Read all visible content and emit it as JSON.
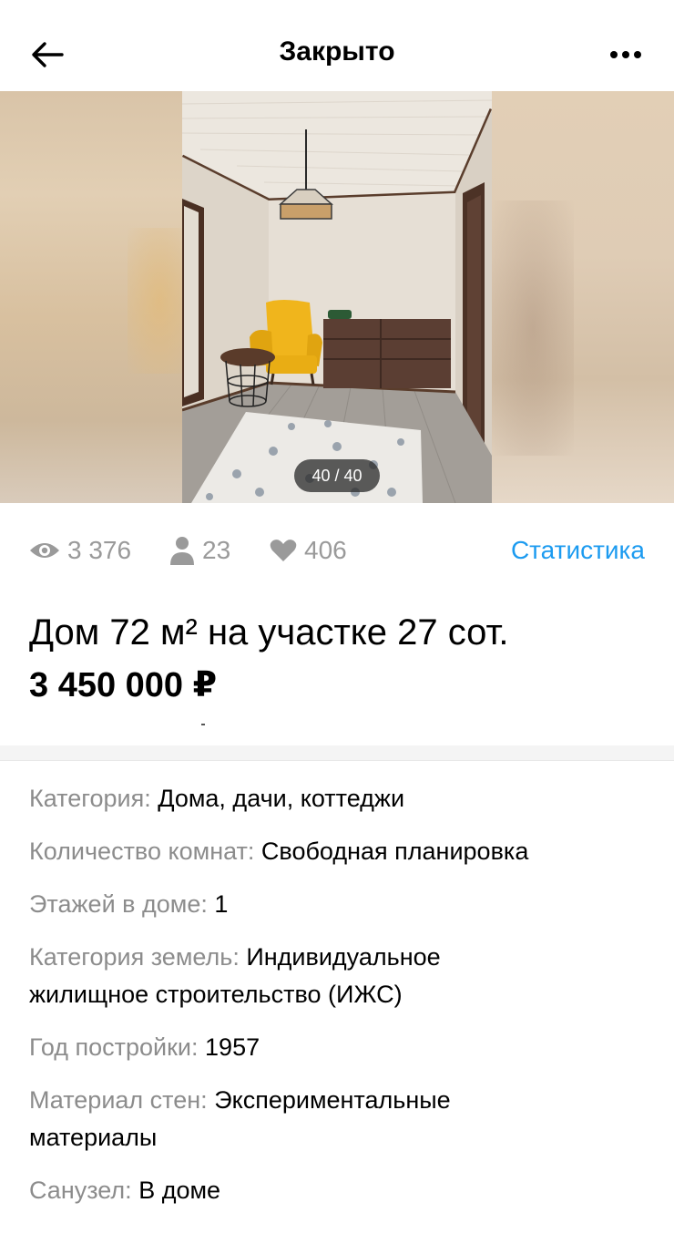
{
  "topbar": {
    "title": "Закрыто",
    "back_icon": "arrow-left-icon",
    "more_icon": "ellipsis-icon"
  },
  "gallery": {
    "counter": "40 / 40"
  },
  "stats": {
    "views": "3 376",
    "contacts": "23",
    "favorites": "406",
    "link": "Статистика",
    "link_color": "#1c9bf0"
  },
  "listing": {
    "title": "Дом 72 м² на участке 27 сот.",
    "price": "3 450 000 ₽"
  },
  "params": [
    {
      "label": "Категория:",
      "value": "Дома, дачи, коттеджи"
    },
    {
      "label": "Количество комнат:",
      "value": "Свободная планировка"
    },
    {
      "label": "Этажей в доме:",
      "value": "1"
    },
    {
      "label": "Категория земель:",
      "value": "Индивидуальное жилищное строительство (ИЖС)"
    },
    {
      "label": "Год постройки:",
      "value": "1957"
    },
    {
      "label": "Материал стен:",
      "value": "Экспериментальные материалы"
    },
    {
      "label": "Санузел:",
      "value": "В доме"
    }
  ]
}
